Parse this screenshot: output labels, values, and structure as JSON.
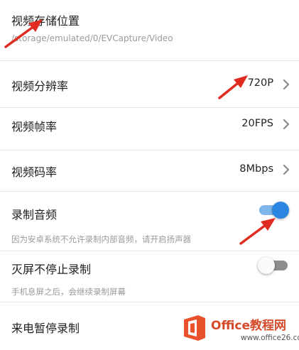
{
  "settings": [
    {
      "title": "视频存储位置",
      "subtitle": "/storage/emulated/0/EVCapture/Video"
    },
    {
      "title": "视频分辨率",
      "value": "720P",
      "icon": "chevron-right-icon"
    },
    {
      "title": "视频帧率",
      "value": "20FPS",
      "icon": "chevron-right-icon"
    },
    {
      "title": "视频码率",
      "value": "8Mbps",
      "icon": "chevron-right-icon"
    },
    {
      "title": "录制音频",
      "subtitle": "因为安卓系统不允许录制内部音频，请开启扬声器",
      "toggle": "on"
    },
    {
      "title": "灭屏不停止录制",
      "subtitle": "手机息屏之后，会继续录制屏幕",
      "toggle": "off"
    },
    {
      "title": "来电暂停录制"
    }
  ],
  "colors": {
    "toggle_on": "#2a86e0",
    "toggle_off": "#8e8e8e",
    "annotation_arrow": "#e02b20"
  },
  "watermark": {
    "title": "Office教程网",
    "site": "www.office26.com",
    "logo_icon": "office-logo-icon"
  }
}
